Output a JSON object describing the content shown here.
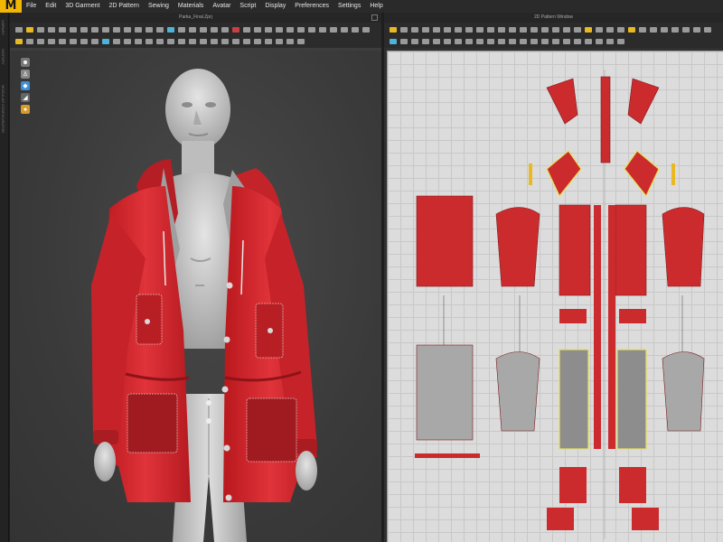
{
  "app": {
    "logo": "M",
    "menu": [
      "File",
      "Edit",
      "3D Garment",
      "2D Pattern",
      "Sewing",
      "Materials",
      "Avatar",
      "Script",
      "Display",
      "Preferences",
      "Settings",
      "Help"
    ]
  },
  "sidestrip": {
    "labels": [
      "LIBRARY",
      "HISTORY",
      "MODULAR CONFIGURATOR"
    ]
  },
  "window_3d": {
    "title": "Parka_Final.Zprj"
  },
  "window_2d": {
    "title": "2D Pattern Window"
  },
  "colors": {
    "garment_red": "#d42a2e",
    "garment_dark_red": "#a81d22",
    "pattern_red": "#cc2b2e",
    "pattern_grey": "#a8a8a8",
    "selection_yellow": "#e7e35a",
    "accent": "#f2b705"
  }
}
